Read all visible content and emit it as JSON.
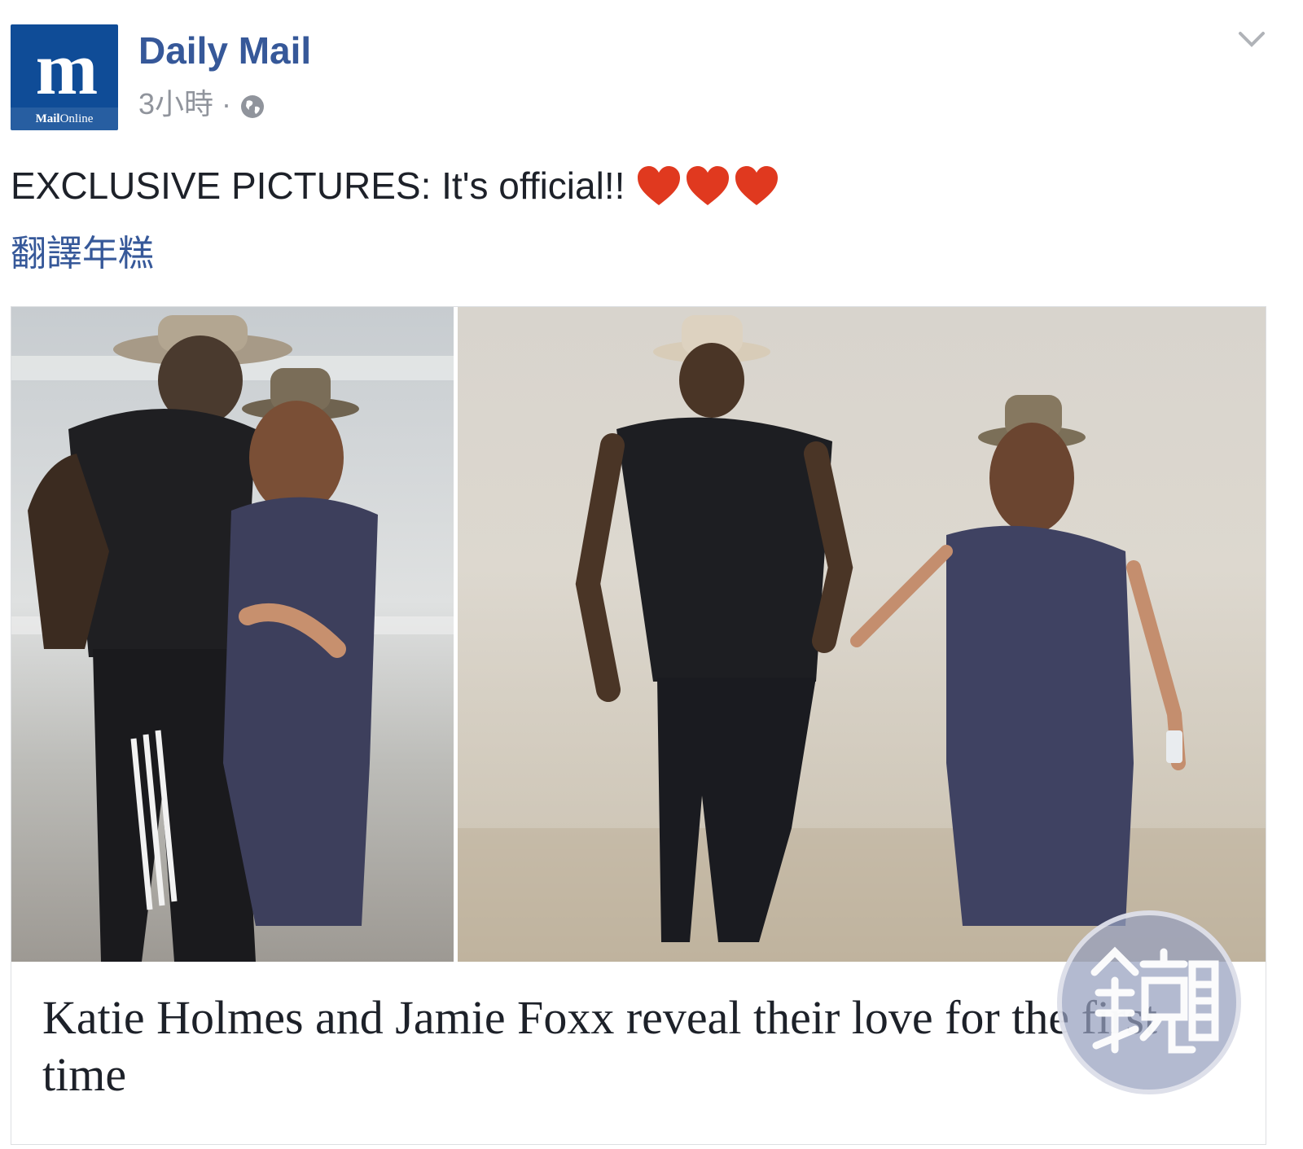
{
  "post": {
    "page_name": "Daily Mail",
    "timestamp": "3小時",
    "separator": "·",
    "privacy_icon": "globe-icon",
    "menu_icon": "chevron-down-icon",
    "avatar": {
      "mark": "m",
      "brand_bold": "Mail",
      "brand_rest": "Online",
      "color": "#0f4c97"
    },
    "message": "EXCLUSIVE PICTURES: It's official!!",
    "emoji": [
      "heart-icon",
      "heart-icon",
      "heart-icon"
    ],
    "heart_color": "#e0391f",
    "translate_label": "翻譯年糕"
  },
  "link_card": {
    "headline": "Katie Holmes and Jamie Foxx reveal their love for the first time",
    "image_left": "photo-couple-beach-closeup",
    "image_right": "photo-couple-walking-beach"
  },
  "watermark": {
    "icon": "mirror-weekly-watermark-icon"
  },
  "colors": {
    "link_blue": "#365899",
    "text": "#1d2129",
    "meta_gray": "#90949c"
  }
}
